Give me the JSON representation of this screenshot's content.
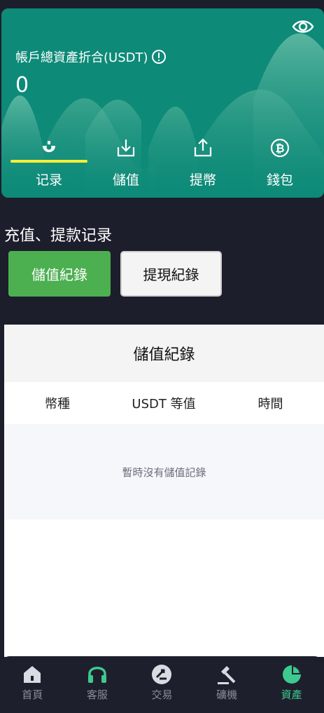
{
  "asset_card": {
    "label": "帳戶總資產折合(USDT)",
    "value": "0",
    "actions": [
      {
        "label": "记录",
        "icon": "record-icon",
        "active": true
      },
      {
        "label": "儲值",
        "icon": "download-icon",
        "active": false
      },
      {
        "label": "提幣",
        "icon": "upload-icon",
        "active": false
      },
      {
        "label": "錢包",
        "icon": "bitcoin-icon",
        "active": false
      }
    ]
  },
  "section_title": "充值、提款记录",
  "buttons": {
    "deposit_records": "儲值紀錄",
    "withdraw_records": "提現紀錄"
  },
  "panel": {
    "title": "儲值紀錄",
    "columns": [
      "幣種",
      "USDT 等值",
      "時間"
    ],
    "empty_text": "暫時沒有儲值記錄"
  },
  "bottom_nav": [
    {
      "label": "首頁",
      "icon": "home-icon"
    },
    {
      "label": "客服",
      "icon": "headset-icon"
    },
    {
      "label": "交易",
      "icon": "exchange-icon"
    },
    {
      "label": "礦機",
      "icon": "mining-icon"
    },
    {
      "label": "資產",
      "icon": "pie-chart-icon",
      "active": true
    }
  ],
  "colors": {
    "card": "#0d8a78",
    "accent_green": "#4caf50",
    "active_nav": "#3ec98e",
    "underline": "#ffee33"
  }
}
